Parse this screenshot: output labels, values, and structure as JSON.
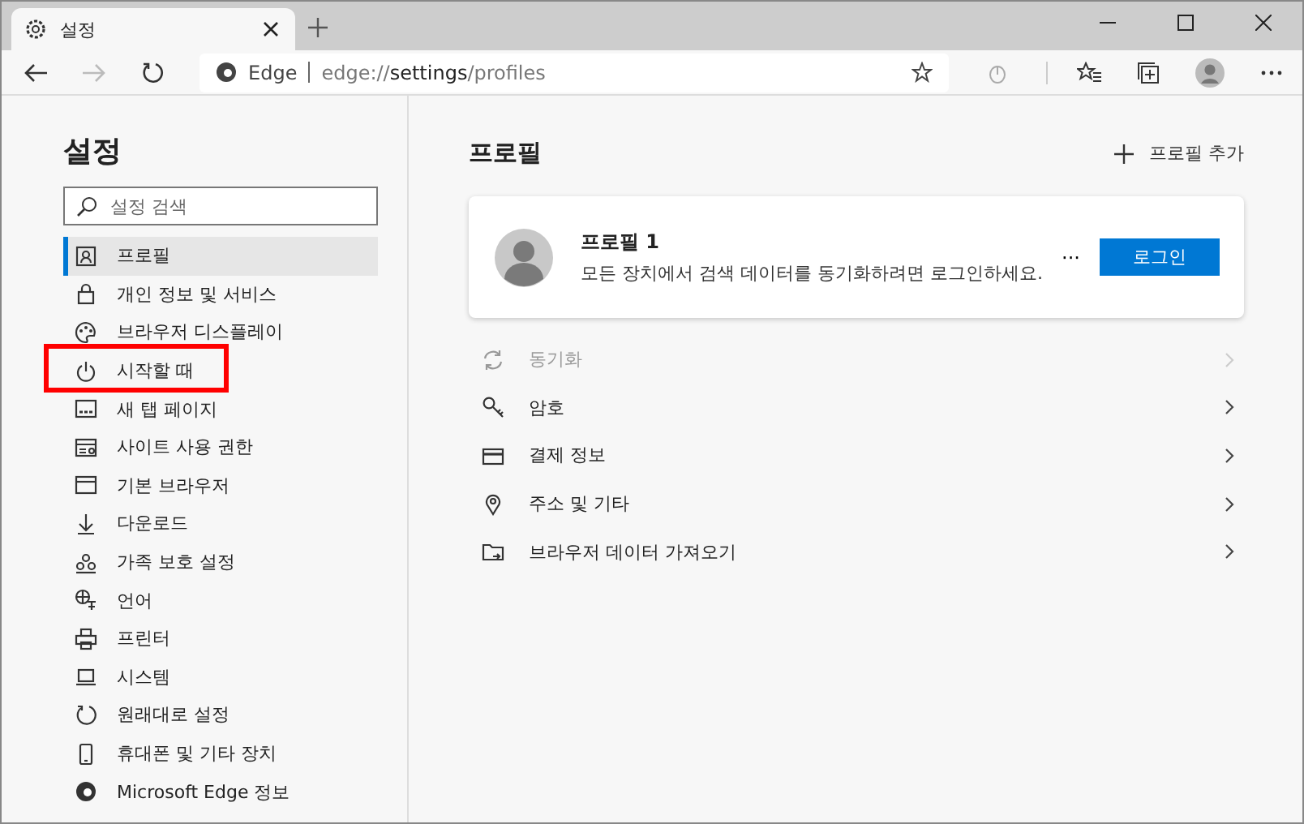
{
  "window": {
    "tab_title": "설정",
    "address_site": "Edge",
    "address_url": "edge://settings/profiles"
  },
  "sidebar": {
    "title": "설정",
    "search": {
      "placeholder": "설정 검색"
    },
    "items": [
      {
        "label": "프로필",
        "kind": "profile",
        "selected": true,
        "highlighted": false
      },
      {
        "label": "개인 정보 및 서비스",
        "kind": "lock",
        "selected": false,
        "highlighted": false
      },
      {
        "label": "브라우저 디스플레이",
        "kind": "palette",
        "selected": false,
        "highlighted": false
      },
      {
        "label": "시작할 때",
        "kind": "power",
        "selected": false,
        "highlighted": true
      },
      {
        "label": "새 탭 페이지",
        "kind": "newtab",
        "selected": false,
        "highlighted": false
      },
      {
        "label": "사이트 사용 권한",
        "kind": "site",
        "selected": false,
        "highlighted": false
      },
      {
        "label": "기본 브라우저",
        "kind": "browser",
        "selected": false,
        "highlighted": false
      },
      {
        "label": "다운로드",
        "kind": "download",
        "selected": false,
        "highlighted": false
      },
      {
        "label": "가족 보호 설정",
        "kind": "family",
        "selected": false,
        "highlighted": false
      },
      {
        "label": "언어",
        "kind": "language",
        "selected": false,
        "highlighted": false
      },
      {
        "label": "프린터",
        "kind": "printer",
        "selected": false,
        "highlighted": false
      },
      {
        "label": "시스템",
        "kind": "system",
        "selected": false,
        "highlighted": false
      },
      {
        "label": "원래대로 설정",
        "kind": "reset",
        "selected": false,
        "highlighted": false
      },
      {
        "label": "휴대폰 및 기타 장치",
        "kind": "phone",
        "selected": false,
        "highlighted": false
      },
      {
        "label": "Microsoft Edge 정보",
        "kind": "edge",
        "selected": false,
        "highlighted": false
      }
    ]
  },
  "main": {
    "title": "프로필",
    "add_button": "프로필 추가",
    "profile_card": {
      "name": "프로필 1",
      "description": "모든 장치에서 검색 데이터를 동기화하려면 로그인하세요.",
      "more": "···",
      "login_button": "로그인"
    },
    "rows": [
      {
        "label": "동기화",
        "kind": "sync",
        "disabled": true
      },
      {
        "label": "암호",
        "kind": "key",
        "disabled": false
      },
      {
        "label": "결제 정보",
        "kind": "card",
        "disabled": false
      },
      {
        "label": "주소 및 기타",
        "kind": "pin",
        "disabled": false
      },
      {
        "label": "브라우저 데이터 가져오기",
        "kind": "folder",
        "disabled": false
      }
    ]
  }
}
